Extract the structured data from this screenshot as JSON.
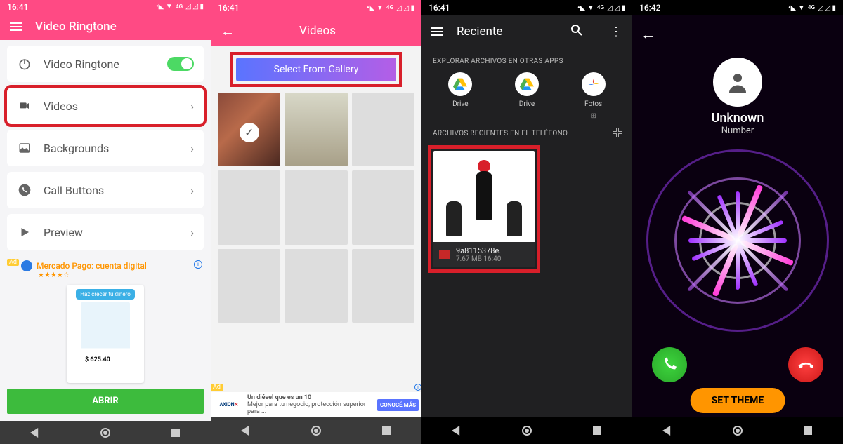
{
  "status": {
    "time1": "16:41",
    "time2": "16:41",
    "time3": "16:41",
    "time4": "16:42",
    "signal": "⁴ᴳ ▲ ▲ ▮"
  },
  "p1": {
    "header": "Video Ringtone",
    "items": [
      {
        "label": "Video Ringtone",
        "toggle": true
      },
      {
        "label": "Videos"
      },
      {
        "label": "Backgrounds"
      },
      {
        "label": "Call Buttons"
      },
      {
        "label": "Preview"
      }
    ],
    "ad": {
      "tag": "Ad",
      "title": "Mercado Pago: cuenta digital",
      "stars": "★★★★☆",
      "bubble": "Haz crecer tu dinero",
      "price": "$ 625.40",
      "cta": "ABRIR"
    }
  },
  "p2": {
    "header": "Videos",
    "gallery_btn": "Select From Gallery",
    "ad": {
      "tag": "Ad",
      "brand": "AXION",
      "headline": "Un diésel que es un 10",
      "sub": "Mejor para tu negocio, protección superior para ...",
      "cta": "CONOCÉ MÁS"
    }
  },
  "p3": {
    "header": "Reciente",
    "section1": "EXPLORAR ARCHIVOS EN OTRAS APPS",
    "apps": [
      {
        "name": "Drive"
      },
      {
        "name": "Drive"
      },
      {
        "name": "Fotos"
      }
    ],
    "section2": "ARCHIVOS RECIENTES EN EL TELÉFONO",
    "file": {
      "name": "9a8115378e...",
      "meta": "7.67 MB 16:40"
    }
  },
  "p4": {
    "caller": "Unknown",
    "sub": "Number",
    "set": "SET THEME"
  }
}
